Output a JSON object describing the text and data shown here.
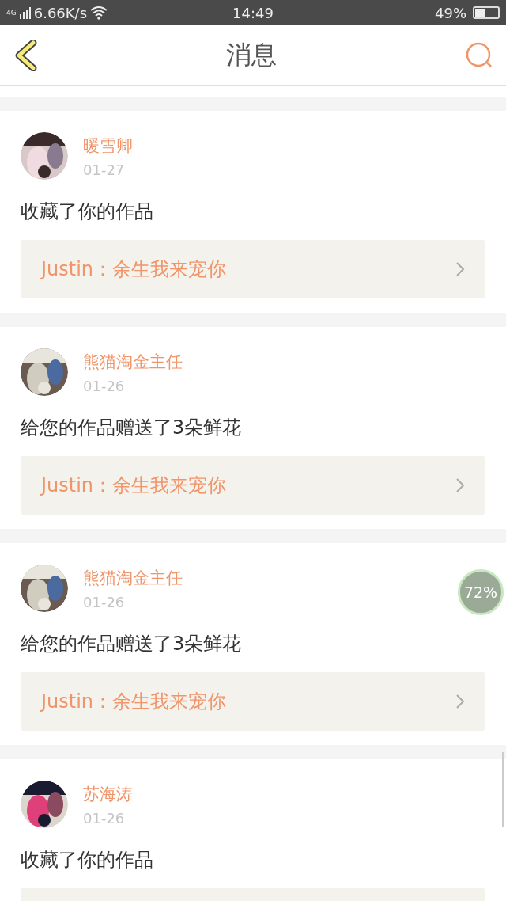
{
  "status_bar": {
    "network": "4G",
    "speed": "6.66K/s",
    "time": "14:49",
    "battery": "49%"
  },
  "header": {
    "title": "消息"
  },
  "messages": [
    {
      "name": "暖雪卿",
      "date": "01-27",
      "text": "收藏了你的作品",
      "work": "Justin：余生我来宠你"
    },
    {
      "name": "熊猫淘金主任",
      "date": "01-26",
      "text": "给您的作品赠送了3朵鲜花",
      "work": "Justin：余生我来宠你"
    },
    {
      "name": "熊猫淘金主任",
      "date": "01-26",
      "text": "给您的作品赠送了3朵鲜花",
      "work": "Justin：余生我来宠你"
    },
    {
      "name": "苏海涛",
      "date": "01-26",
      "text": "收藏了你的作品",
      "work_cut": true
    }
  ],
  "floating_badge": {
    "text": "72%"
  }
}
